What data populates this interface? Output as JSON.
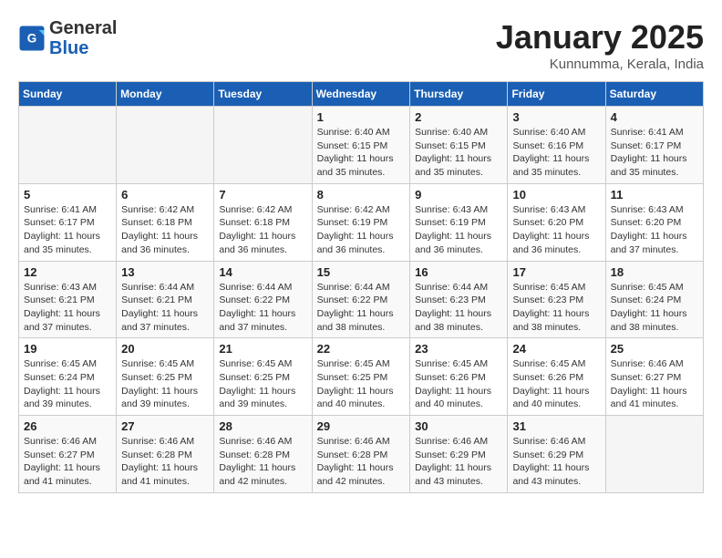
{
  "header": {
    "logo_general": "General",
    "logo_blue": "Blue",
    "title": "January 2025",
    "subtitle": "Kunnumma, Kerala, India"
  },
  "weekdays": [
    "Sunday",
    "Monday",
    "Tuesday",
    "Wednesday",
    "Thursday",
    "Friday",
    "Saturday"
  ],
  "weeks": [
    [
      {
        "day": "",
        "info": ""
      },
      {
        "day": "",
        "info": ""
      },
      {
        "day": "",
        "info": ""
      },
      {
        "day": "1",
        "info": "Sunrise: 6:40 AM\nSunset: 6:15 PM\nDaylight: 11 hours and 35 minutes."
      },
      {
        "day": "2",
        "info": "Sunrise: 6:40 AM\nSunset: 6:15 PM\nDaylight: 11 hours and 35 minutes."
      },
      {
        "day": "3",
        "info": "Sunrise: 6:40 AM\nSunset: 6:16 PM\nDaylight: 11 hours and 35 minutes."
      },
      {
        "day": "4",
        "info": "Sunrise: 6:41 AM\nSunset: 6:17 PM\nDaylight: 11 hours and 35 minutes."
      }
    ],
    [
      {
        "day": "5",
        "info": "Sunrise: 6:41 AM\nSunset: 6:17 PM\nDaylight: 11 hours and 35 minutes."
      },
      {
        "day": "6",
        "info": "Sunrise: 6:42 AM\nSunset: 6:18 PM\nDaylight: 11 hours and 36 minutes."
      },
      {
        "day": "7",
        "info": "Sunrise: 6:42 AM\nSunset: 6:18 PM\nDaylight: 11 hours and 36 minutes."
      },
      {
        "day": "8",
        "info": "Sunrise: 6:42 AM\nSunset: 6:19 PM\nDaylight: 11 hours and 36 minutes."
      },
      {
        "day": "9",
        "info": "Sunrise: 6:43 AM\nSunset: 6:19 PM\nDaylight: 11 hours and 36 minutes."
      },
      {
        "day": "10",
        "info": "Sunrise: 6:43 AM\nSunset: 6:20 PM\nDaylight: 11 hours and 36 minutes."
      },
      {
        "day": "11",
        "info": "Sunrise: 6:43 AM\nSunset: 6:20 PM\nDaylight: 11 hours and 37 minutes."
      }
    ],
    [
      {
        "day": "12",
        "info": "Sunrise: 6:43 AM\nSunset: 6:21 PM\nDaylight: 11 hours and 37 minutes."
      },
      {
        "day": "13",
        "info": "Sunrise: 6:44 AM\nSunset: 6:21 PM\nDaylight: 11 hours and 37 minutes."
      },
      {
        "day": "14",
        "info": "Sunrise: 6:44 AM\nSunset: 6:22 PM\nDaylight: 11 hours and 37 minutes."
      },
      {
        "day": "15",
        "info": "Sunrise: 6:44 AM\nSunset: 6:22 PM\nDaylight: 11 hours and 38 minutes."
      },
      {
        "day": "16",
        "info": "Sunrise: 6:44 AM\nSunset: 6:23 PM\nDaylight: 11 hours and 38 minutes."
      },
      {
        "day": "17",
        "info": "Sunrise: 6:45 AM\nSunset: 6:23 PM\nDaylight: 11 hours and 38 minutes."
      },
      {
        "day": "18",
        "info": "Sunrise: 6:45 AM\nSunset: 6:24 PM\nDaylight: 11 hours and 38 minutes."
      }
    ],
    [
      {
        "day": "19",
        "info": "Sunrise: 6:45 AM\nSunset: 6:24 PM\nDaylight: 11 hours and 39 minutes."
      },
      {
        "day": "20",
        "info": "Sunrise: 6:45 AM\nSunset: 6:25 PM\nDaylight: 11 hours and 39 minutes."
      },
      {
        "day": "21",
        "info": "Sunrise: 6:45 AM\nSunset: 6:25 PM\nDaylight: 11 hours and 39 minutes."
      },
      {
        "day": "22",
        "info": "Sunrise: 6:45 AM\nSunset: 6:25 PM\nDaylight: 11 hours and 40 minutes."
      },
      {
        "day": "23",
        "info": "Sunrise: 6:45 AM\nSunset: 6:26 PM\nDaylight: 11 hours and 40 minutes."
      },
      {
        "day": "24",
        "info": "Sunrise: 6:45 AM\nSunset: 6:26 PM\nDaylight: 11 hours and 40 minutes."
      },
      {
        "day": "25",
        "info": "Sunrise: 6:46 AM\nSunset: 6:27 PM\nDaylight: 11 hours and 41 minutes."
      }
    ],
    [
      {
        "day": "26",
        "info": "Sunrise: 6:46 AM\nSunset: 6:27 PM\nDaylight: 11 hours and 41 minutes."
      },
      {
        "day": "27",
        "info": "Sunrise: 6:46 AM\nSunset: 6:28 PM\nDaylight: 11 hours and 41 minutes."
      },
      {
        "day": "28",
        "info": "Sunrise: 6:46 AM\nSunset: 6:28 PM\nDaylight: 11 hours and 42 minutes."
      },
      {
        "day": "29",
        "info": "Sunrise: 6:46 AM\nSunset: 6:28 PM\nDaylight: 11 hours and 42 minutes."
      },
      {
        "day": "30",
        "info": "Sunrise: 6:46 AM\nSunset: 6:29 PM\nDaylight: 11 hours and 43 minutes."
      },
      {
        "day": "31",
        "info": "Sunrise: 6:46 AM\nSunset: 6:29 PM\nDaylight: 11 hours and 43 minutes."
      },
      {
        "day": "",
        "info": ""
      }
    ]
  ]
}
